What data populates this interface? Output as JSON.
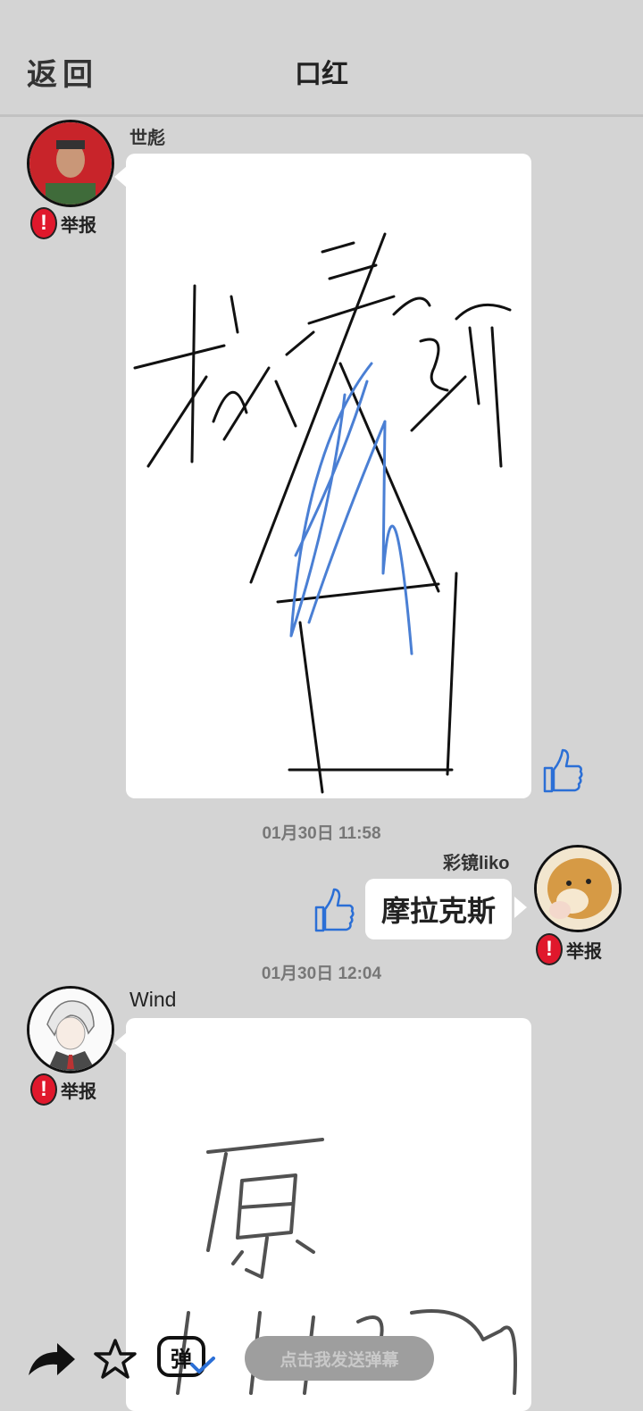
{
  "header": {
    "back_label": "返回",
    "title": "口红"
  },
  "messages": [
    {
      "user": "世彪",
      "report_label": "举报",
      "type": "drawing"
    },
    {
      "user": "彩镜liko",
      "report_label": "举报",
      "type": "text",
      "text": "摩拉克斯"
    },
    {
      "user": "Wind",
      "report_label": "举报",
      "type": "drawing"
    }
  ],
  "timestamps": [
    "01月30日  11:58",
    "01月30日  12:04"
  ],
  "bottom_bar": {
    "icons": [
      "share-icon",
      "star-icon",
      "danmaku-icon"
    ],
    "danmaku_glyph": "弹",
    "send_placeholder": "点击我发送弹幕"
  },
  "colors": {
    "background": "#d4d4d4",
    "report_red": "#e0182c",
    "like_blue": "#2b6fd6",
    "stroke_blue": "#4a7fd4"
  }
}
